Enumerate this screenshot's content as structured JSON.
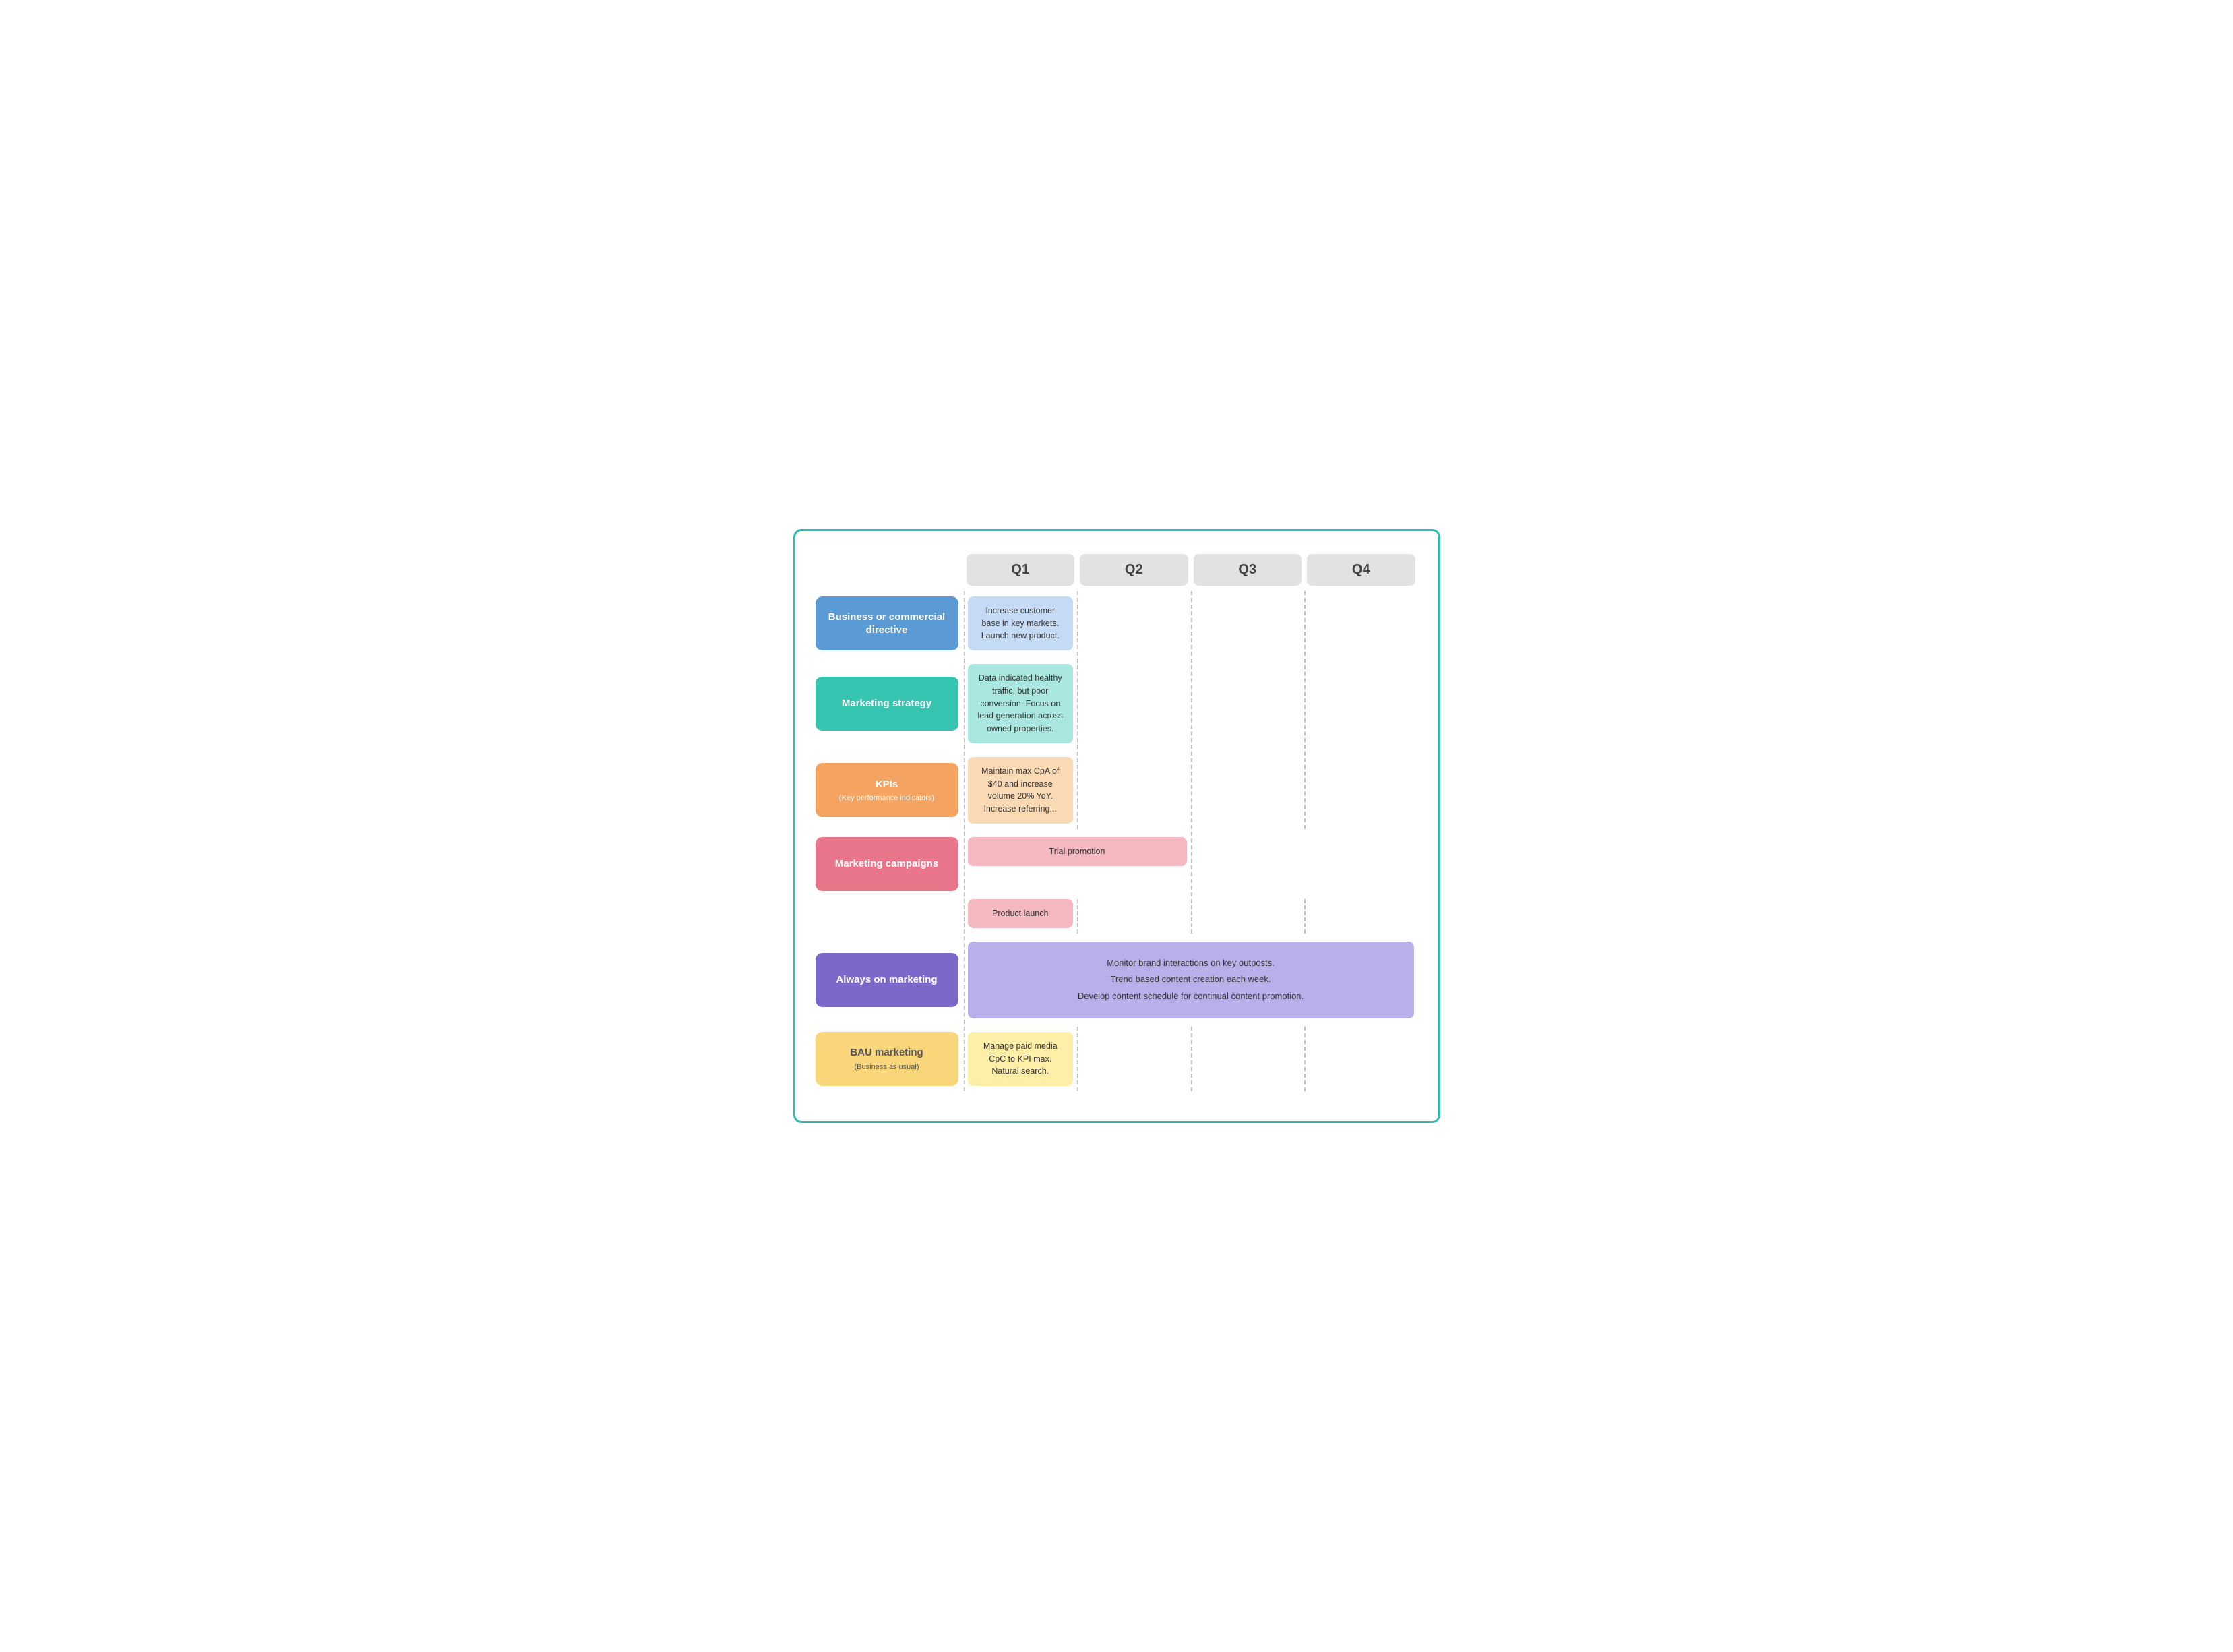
{
  "quarters": [
    "Q1",
    "Q2",
    "Q3",
    "Q4"
  ],
  "rows": [
    {
      "id": "business",
      "label": "Business or commercial directive",
      "labelColor": "blue",
      "q1": "Increase customer base in key markets. Launch new product.",
      "q1Color": "box-blue",
      "q2": "",
      "q3": "",
      "q4": ""
    },
    {
      "id": "strategy",
      "label": "Marketing strategy",
      "labelColor": "teal",
      "q1": "Data indicated healthy traffic, but poor conversion. Focus on lead generation across owned properties.",
      "q1Color": "box-teal",
      "q2": "",
      "q3": "",
      "q4": ""
    },
    {
      "id": "kpis",
      "label": "KPIs",
      "labelSub": "(Key performance indicators)",
      "labelColor": "orange",
      "q1": "Maintain max CpA of $40 and increase volume 20% YoY.\nIncrease referring...",
      "q1Color": "box-orange",
      "q2": "",
      "q3": "",
      "q4": ""
    },
    {
      "id": "campaigns",
      "label": "Marketing campaigns",
      "labelColor": "pink",
      "trial": "Trial promotion",
      "product": "Product launch"
    },
    {
      "id": "always",
      "label": "Always on marketing",
      "labelColor": "purple",
      "content": "Monitor brand interactions on key outposts.\nTrend based content creation each week.\nDevelop content schedule for continual content promotion."
    },
    {
      "id": "bau",
      "label": "BAU marketing",
      "labelSub": "(Business as usual)",
      "labelColor": "yellow",
      "q1": "Manage paid media CpC to KPI max.\nNatural search.",
      "q1Color": "box-yellow",
      "q2": "",
      "q3": "",
      "q4": ""
    }
  ]
}
